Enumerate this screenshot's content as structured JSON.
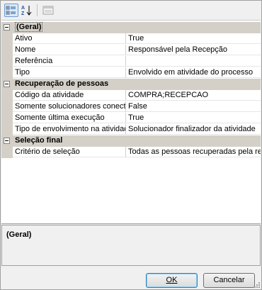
{
  "toolbar": {
    "categorized_icon": "categorized-view-icon",
    "alphabetical_icon": "alphabetical-sort-icon",
    "property_pages_icon": "property-pages-icon"
  },
  "categories": [
    {
      "label": "(Geral)",
      "properties": [
        {
          "name": "Ativo",
          "value": "True"
        },
        {
          "name": "Nome",
          "value": "Responsável pela Recepção"
        },
        {
          "name": "Referência",
          "value": ""
        },
        {
          "name": "Tipo",
          "value": "Envolvido em atividade do processo"
        }
      ]
    },
    {
      "label": "Recuperação de pessoas",
      "properties": [
        {
          "name": "Código da atividade",
          "value": "COMPRA;RECEPCAO"
        },
        {
          "name": "Somente solucionadores conecta",
          "value": "False"
        },
        {
          "name": "Somente última execução",
          "value": "True"
        },
        {
          "name": "Tipo de envolvimento na atividad",
          "value": "Solucionador finalizador da atividade"
        }
      ]
    },
    {
      "label": "Seleção final",
      "properties": [
        {
          "name": "Critério de seleção",
          "value": "Todas as pessoas recuperadas pela reg"
        }
      ]
    }
  ],
  "help": {
    "title": "(Geral)"
  },
  "buttons": {
    "ok": "OK",
    "cancel": "Cancelar"
  },
  "colors": {
    "category_bg": "#d4d0c8",
    "grid_bg": "#ffffff",
    "window_bg": "#f0f0f0"
  }
}
